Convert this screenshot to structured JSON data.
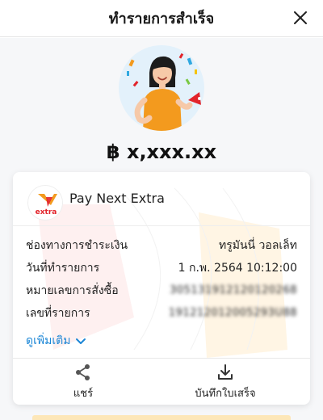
{
  "header": {
    "title": "ทำรายการสำเร็จ",
    "close_icon": "close-icon"
  },
  "summary": {
    "amount": "฿ x,xxx.xx",
    "illustration": "celebration-illustration"
  },
  "card": {
    "merchant": {
      "name": "Pay Next Extra",
      "logo_text": "extra",
      "logo_icon": "pay-next-extra-logo"
    },
    "rows": [
      {
        "label": "ช่องทางการชำระเงิน",
        "value": "ทรูมันนี่ วอลเล็ท"
      },
      {
        "label": "วันที่ทำรายการ",
        "value": "1 ก.พ. 2564 10:12:00"
      },
      {
        "label": "หมายเลขการสั่งซื้อ",
        "value": "305131912120120268"
      },
      {
        "label": "เลขที่รายการ",
        "value": "191212012005293U88"
      }
    ],
    "more_label": "ดูเพิ่มเติม",
    "actions": {
      "share_label": "แชร์",
      "save_label": "บันทึกใบเสร็จ"
    }
  },
  "colors": {
    "link": "#1b86d6",
    "logo_orange": "#f39a1e",
    "logo_red": "#e2242b",
    "hero_bg": "#e3f1fb"
  }
}
